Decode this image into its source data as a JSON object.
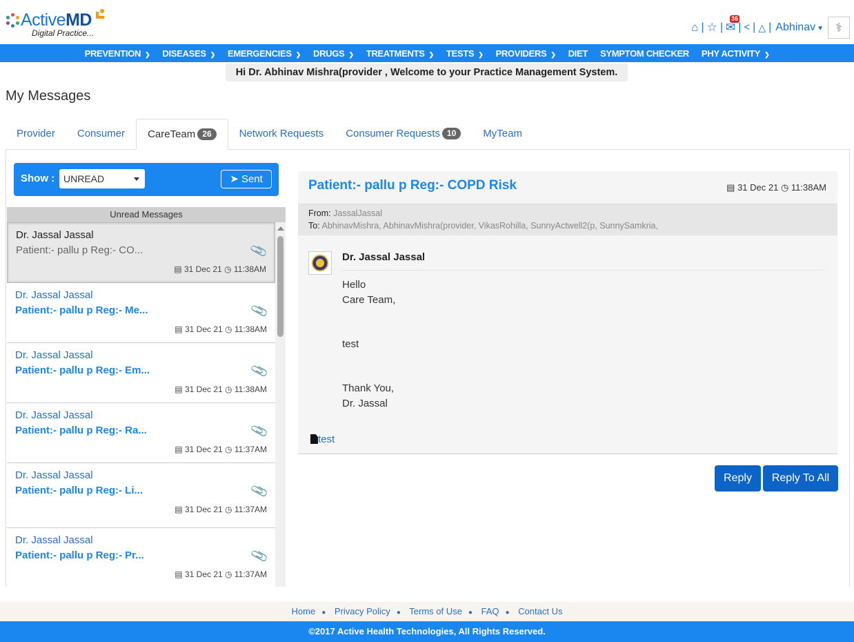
{
  "header": {
    "brand_prefix": "Active",
    "brand_suffix": "MD",
    "tagline": "Digital Practice...",
    "user_name": "Abhinav",
    "mail_count": "36"
  },
  "nav": [
    {
      "label": "PREVENTION",
      "dropdown": true
    },
    {
      "label": "DISEASES",
      "dropdown": true
    },
    {
      "label": "EMERGENCIES",
      "dropdown": true
    },
    {
      "label": "DRUGS",
      "dropdown": true
    },
    {
      "label": "TREATMENTS",
      "dropdown": true
    },
    {
      "label": "TESTS",
      "dropdown": true
    },
    {
      "label": "PROVIDERS",
      "dropdown": true
    },
    {
      "label": "DIET",
      "dropdown": false
    },
    {
      "label": "SYMPTOM CHECKER",
      "dropdown": false
    },
    {
      "label": "PHY ACTIVITY",
      "dropdown": true
    }
  ],
  "welcome": "Hi Dr. Abhinav Mishra(provider , Welcome to your Practice Management System.",
  "page_title": "My Messages",
  "tabs": [
    {
      "label": "Provider",
      "count": ""
    },
    {
      "label": "Consumer",
      "count": ""
    },
    {
      "label": "CareTeam",
      "count": "26"
    },
    {
      "label": "Network Requests",
      "count": ""
    },
    {
      "label": "Consumer Requests",
      "count": "10"
    },
    {
      "label": "MyTeam",
      "count": ""
    }
  ],
  "filter": {
    "show_label": "Show :",
    "selected": "UNREAD",
    "sent_label": "Sent"
  },
  "list_header": "Unread Messages",
  "messages": [
    {
      "sender": "Dr. Jassal Jassal",
      "subject": "Patient:- pallu p Reg:- CO...",
      "date": "31 Dec 21",
      "time": "11:38AM"
    },
    {
      "sender": "Dr. Jassal Jassal",
      "subject": "Patient:- pallu p Reg:- Me...",
      "date": "31 Dec 21",
      "time": "11:38AM"
    },
    {
      "sender": "Dr. Jassal Jassal",
      "subject": "Patient:- pallu p Reg:- Em...",
      "date": "31 Dec 21",
      "time": "11:38AM"
    },
    {
      "sender": "Dr. Jassal Jassal",
      "subject": "Patient:- pallu p Reg:- Ra...",
      "date": "31 Dec 21",
      "time": "11:37AM"
    },
    {
      "sender": "Dr. Jassal Jassal",
      "subject": "Patient:- pallu p Reg:- Li...",
      "date": "31 Dec 21",
      "time": "11:37AM"
    },
    {
      "sender": "Dr. Jassal Jassal",
      "subject": "Patient:- pallu p Reg:- Pr...",
      "date": "31 Dec 21",
      "time": "11:37AM"
    }
  ],
  "detail": {
    "title": "Patient:- pallu p Reg:- COPD Risk",
    "date": "31 Dec 21",
    "time": "11:38AM",
    "from_label": "From:",
    "from": "JassalJassal",
    "to_label": "To:",
    "to": "AbhinavMishra, AbhinavMishra(provider, VikasRohilla, SunnyActwell2(p, SunnySamkria,",
    "sender": "Dr. Jassal Jassal",
    "line1": "Hello",
    "line2": "Care Team,",
    "line3": "test",
    "line4": "Thank You,",
    "line5": "Dr. Jassal",
    "attachment": "test"
  },
  "actions": {
    "reply": "Reply",
    "reply_all": "Reply To All"
  },
  "footer": {
    "links": [
      "Home",
      "Privacy Policy",
      "Terms of Use",
      "FAQ",
      "Contact Us"
    ],
    "copyright": "©2017 Active Health Technologies, All Rights Reserved."
  }
}
